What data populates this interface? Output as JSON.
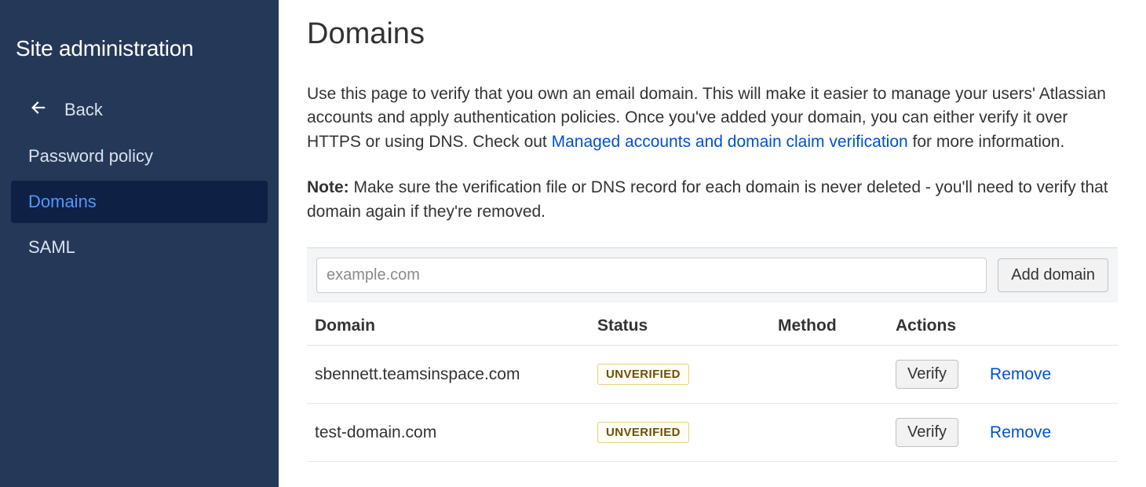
{
  "sidebar": {
    "title": "Site administration",
    "back_label": "Back",
    "items": [
      {
        "label": "Password policy",
        "active": false
      },
      {
        "label": "Domains",
        "active": true
      },
      {
        "label": "SAML",
        "active": false
      }
    ]
  },
  "page": {
    "title": "Domains",
    "description_before_link": "Use this page to verify that you own an email domain. This will make it easier to manage your users' Atlassian accounts and apply authentication policies. Once you've added your domain, you can either verify it over HTTPS or using DNS. Check out ",
    "description_link_text": "Managed accounts and domain claim verification",
    "description_after_link": " for more information.",
    "note_label": "Note:",
    "note_text": " Make sure the verification file or DNS record for each domain is never deleted - you'll need to verify that domain again if they're removed."
  },
  "add_bar": {
    "input_placeholder": "example.com",
    "add_button_label": "Add domain"
  },
  "table": {
    "columns": {
      "domain": "Domain",
      "status": "Status",
      "method": "Method",
      "actions": "Actions"
    },
    "verify_label": "Verify",
    "remove_label": "Remove",
    "rows": [
      {
        "domain": "sbennett.teamsinspace.com",
        "status": "UNVERIFIED",
        "method": ""
      },
      {
        "domain": "test-domain.com",
        "status": "UNVERIFIED",
        "method": ""
      }
    ]
  },
  "colors": {
    "sidebar_bg": "#253858",
    "sidebar_active_bg": "#0e2043",
    "link": "#0052CC",
    "badge_text": "#6B5100",
    "badge_border": "#E6D27A"
  }
}
